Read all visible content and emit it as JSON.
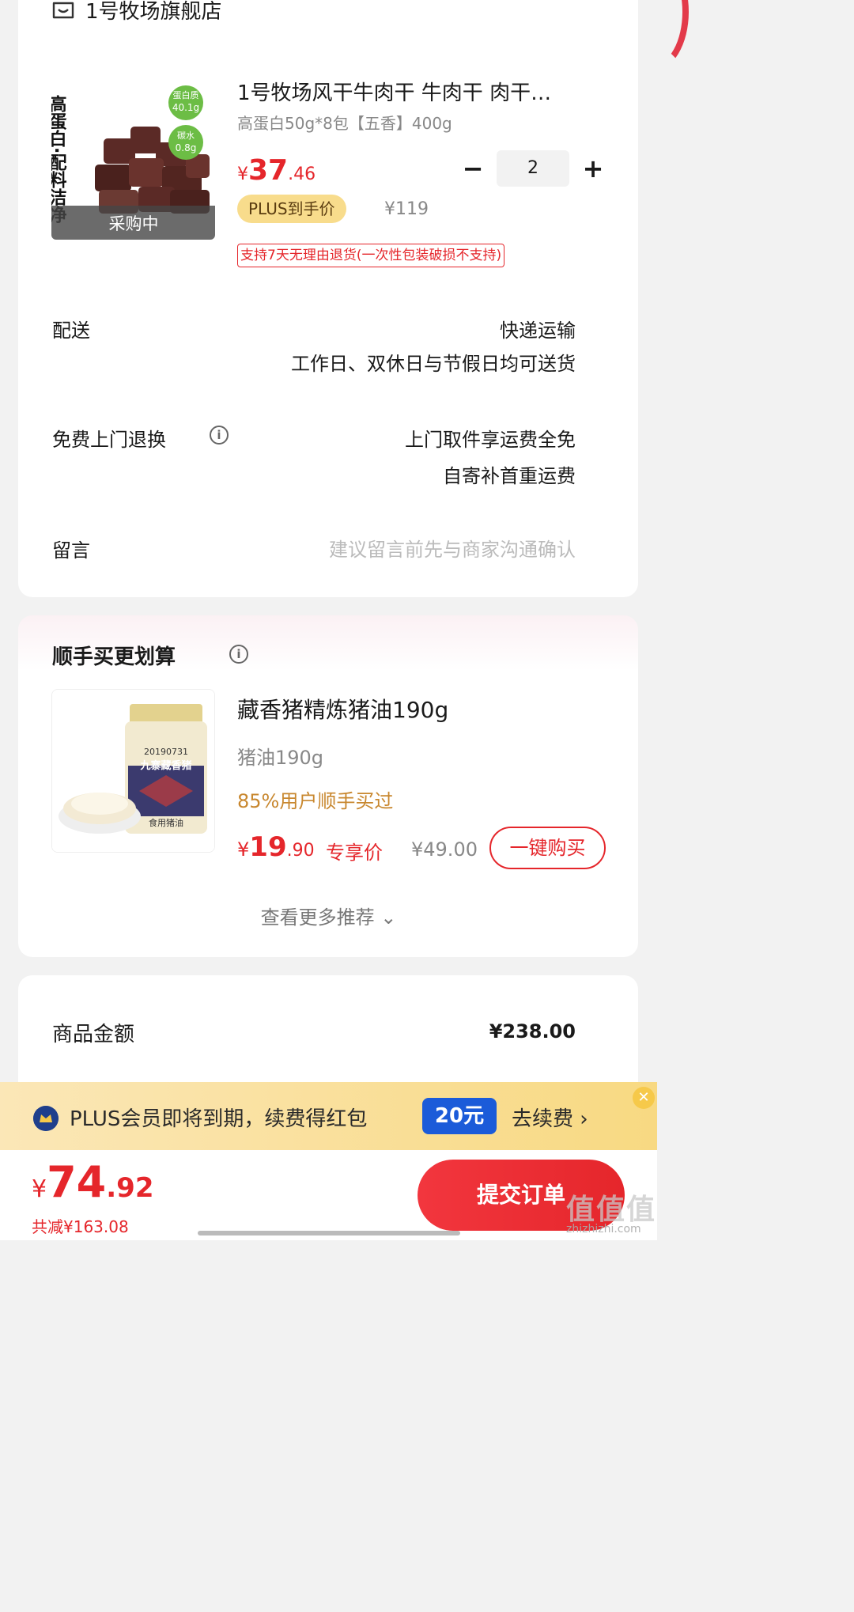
{
  "store": {
    "name": "1号牧场旗舰店",
    "icon": "store-icon"
  },
  "product": {
    "image_labels": {
      "headline": "高蛋白·配料洁净",
      "protein": "蛋白质",
      "protein_value": "40.1g",
      "carb": "碳水",
      "carb_value": "0.8g",
      "status": "采购中"
    },
    "title": "1号牧场风干牛肉干 牛肉干 肉干…",
    "spec": "高蛋白50g*8包【五香】400g",
    "price_symbol": "¥",
    "price_int": "37",
    "price_dec": ".46",
    "quantity": "2",
    "minus": "−",
    "plus": "+",
    "plus_badge": "PLUS到手价",
    "original_price": "¥119",
    "return_tag": "支持7天无理由退货(一次性包装破损不支持)"
  },
  "delivery": {
    "label": "配送",
    "method": "快递运输",
    "schedule": "工作日、双休日与节假日均可送货"
  },
  "free_return": {
    "label": "免费上门退换",
    "line1": "上门取件享运费全免",
    "line2": "自寄补首重运费"
  },
  "message": {
    "label": "留言",
    "placeholder": "建议留言前先与商家沟通确认"
  },
  "recommend": {
    "title": "顺手买更划算",
    "image_labels": {
      "date": "20190731",
      "brand": "九寨藏香猪",
      "type": "食用猪油"
    },
    "item_title": "藏香猪精炼猪油190g",
    "item_spec": "猪油190g",
    "bought": "85%用户顺手买过",
    "price_symbol": "¥",
    "price_int": "19",
    "price_dec": ".90",
    "exclusive": "专享价",
    "original_price": "¥49.00",
    "buy_button": "一键购买",
    "more": "查看更多推荐 ⌄"
  },
  "summary": {
    "goods_amount_label": "商品金额",
    "goods_amount": "¥238.00"
  },
  "banner": {
    "text": "PLUS会员即将到期，续费得红包",
    "badge": "20元",
    "renew": "去续费 ›",
    "close": "✕"
  },
  "footer": {
    "price_symbol": "¥",
    "total_int": "74",
    "total_dec": ".92",
    "saved": "共减¥163.08",
    "submit": "提交订单"
  },
  "watermark": {
    "main": "值值值",
    "sub": "zhizhizhi.com"
  },
  "colors": {
    "accent": "#e5262b",
    "plus_gold": "#f8dc8c",
    "banner_blue": "#1b5bd9"
  }
}
